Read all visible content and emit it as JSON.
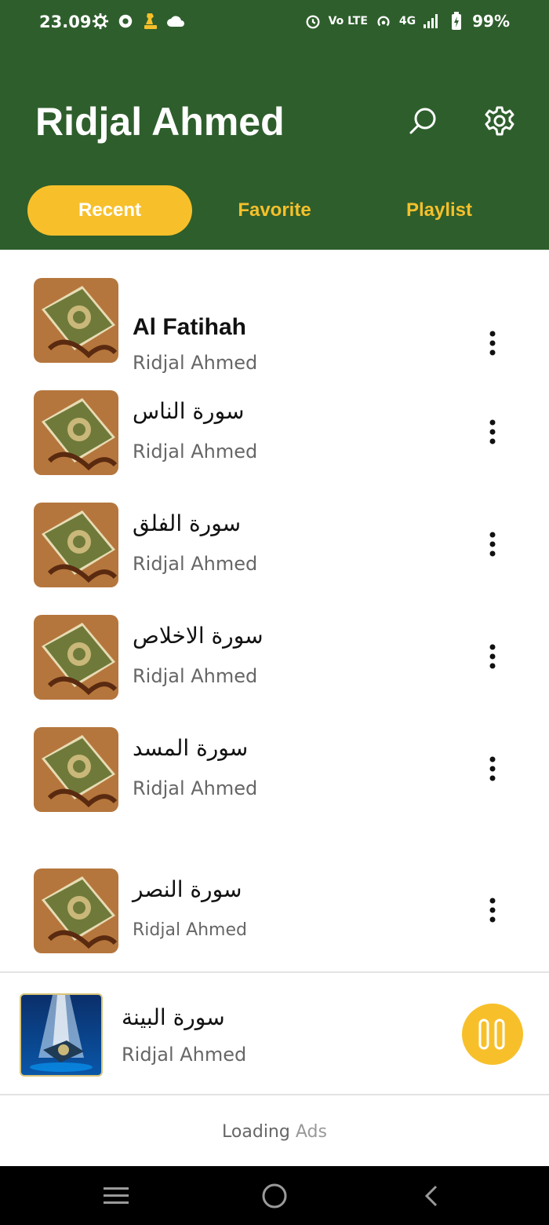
{
  "status_bar": {
    "time": "23.09",
    "network": "4G",
    "volte": "Vo LTE",
    "battery": "99%",
    "icons": [
      "gear-icon",
      "gear-badge-icon",
      "chess-icon",
      "cloud-icon",
      "alarm-icon",
      "volte-icon",
      "hotspot-icon",
      "signal-icon",
      "battery-charging-icon"
    ]
  },
  "header": {
    "title": "Ridjal Ahmed",
    "icons": [
      "search-icon",
      "settings-gear-icon"
    ]
  },
  "tabs": [
    {
      "label": "Recent",
      "active": true
    },
    {
      "label": "Favorite",
      "active": false
    },
    {
      "label": "Playlist",
      "active": false
    }
  ],
  "tracks": [
    {
      "title": "Al Fatihah",
      "artist": "Ridjal Ahmed"
    },
    {
      "title": "سورة الناس",
      "artist": "Ridjal Ahmed"
    },
    {
      "title": "سورة الفلق",
      "artist": "Ridjal Ahmed"
    },
    {
      "title": "سورة الاخلاص",
      "artist": "Ridjal Ahmed"
    },
    {
      "title": "سورة المسد",
      "artist": "Ridjal Ahmed"
    },
    {
      "title": "سورة النصر",
      "artist": "Ridjal Ahmed"
    }
  ],
  "now_playing": {
    "title": "سورة البينة",
    "artist": "Ridjal Ahmed"
  },
  "ads": {
    "loading": "Loading",
    "ads": "Ads"
  },
  "colors": {
    "header_green": "#2e5e2c",
    "accent_yellow": "#f7c02b",
    "artist_gray": "#666666"
  }
}
